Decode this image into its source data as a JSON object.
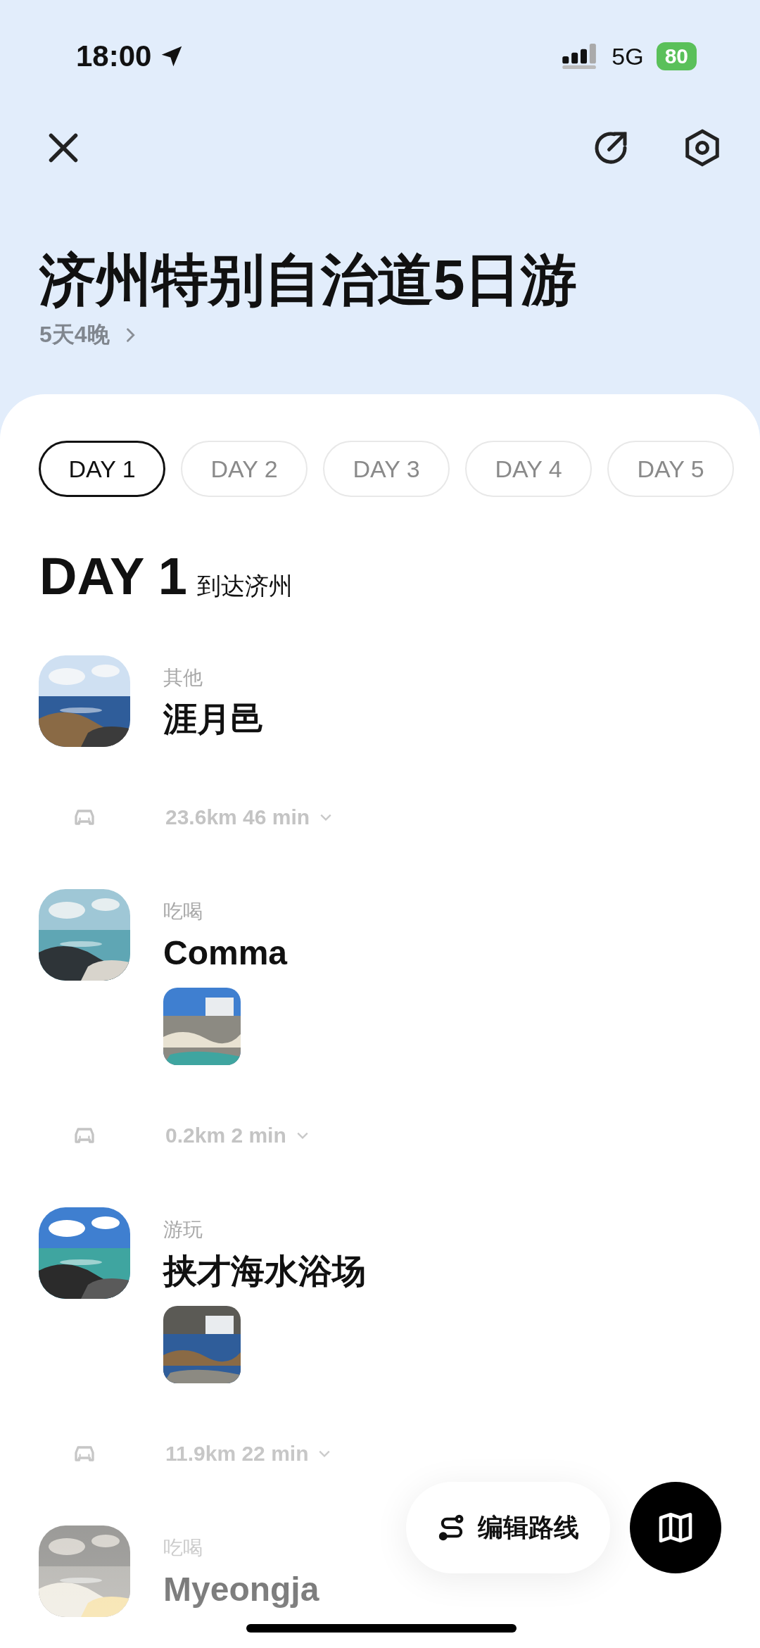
{
  "status_bar": {
    "time": "18:00",
    "network": "5G",
    "battery": "80"
  },
  "header": {
    "title": "济州特别自治道5日游",
    "subtitle": "5天4晚"
  },
  "tabs": [
    {
      "label": "DAY 1",
      "selected": true
    },
    {
      "label": "DAY 2",
      "selected": false
    },
    {
      "label": "DAY 3",
      "selected": false
    },
    {
      "label": "DAY 4",
      "selected": false
    },
    {
      "label": "DAY 5",
      "selected": false
    }
  ],
  "day": {
    "label": "DAY 1",
    "subtitle": "到达济州"
  },
  "stops": [
    {
      "category": "其他",
      "name": "涯月邑",
      "travel": "23.6km 46 min"
    },
    {
      "category": "吃喝",
      "name": "Comma",
      "travel": "0.2km 2 min"
    },
    {
      "category": "游玩",
      "name": "挟才海水浴场",
      "travel": "11.9km 22 min"
    },
    {
      "category": "吃喝",
      "name": "Myeongja"
    }
  ],
  "actions": {
    "edit_route": "编辑路线"
  }
}
